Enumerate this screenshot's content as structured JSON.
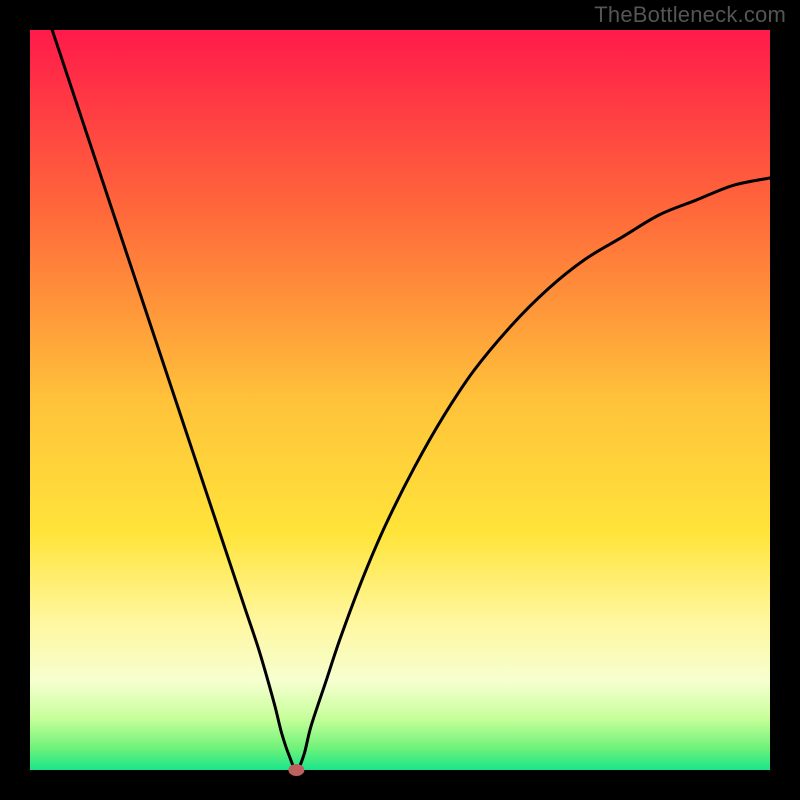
{
  "watermark": "TheBottleneck.com",
  "colors": {
    "frame": "#000000",
    "curve": "#000000",
    "marker": "#bc6060"
  },
  "chart_data": {
    "type": "line",
    "title": "",
    "xlabel": "",
    "ylabel": "",
    "xlim": [
      0,
      100
    ],
    "ylim": [
      0,
      100
    ],
    "gradient_stops": [
      {
        "offset": 0.0,
        "color": "#ff1a4a"
      },
      {
        "offset": 0.25,
        "color": "#ff6a3a"
      },
      {
        "offset": 0.5,
        "color": "#ffc23a"
      },
      {
        "offset": 0.68,
        "color": "#ffe43a"
      },
      {
        "offset": 0.8,
        "color": "#fff7a0"
      },
      {
        "offset": 0.88,
        "color": "#f6ffd0"
      },
      {
        "offset": 0.93,
        "color": "#c7ff9a"
      },
      {
        "offset": 0.97,
        "color": "#70f27a"
      },
      {
        "offset": 1.0,
        "color": "#18e58a"
      }
    ],
    "series": [
      {
        "name": "bottleneck-curve",
        "x": [
          3,
          5,
          7,
          9,
          11,
          13,
          15,
          17,
          19,
          21,
          23,
          25,
          27,
          29,
          31,
          33,
          34,
          35,
          36,
          37,
          38,
          40,
          42,
          45,
          48,
          52,
          56,
          60,
          65,
          70,
          75,
          80,
          85,
          90,
          95,
          100
        ],
        "y": [
          100,
          94,
          88,
          82,
          76,
          70,
          64,
          58,
          52,
          46,
          40,
          34,
          28,
          22,
          16,
          9,
          5,
          2,
          0,
          2,
          6,
          12,
          18,
          26,
          33,
          41,
          48,
          54,
          60,
          65,
          69,
          72,
          75,
          77,
          79,
          80
        ]
      }
    ],
    "marker": {
      "x": 36,
      "y": 0
    }
  }
}
